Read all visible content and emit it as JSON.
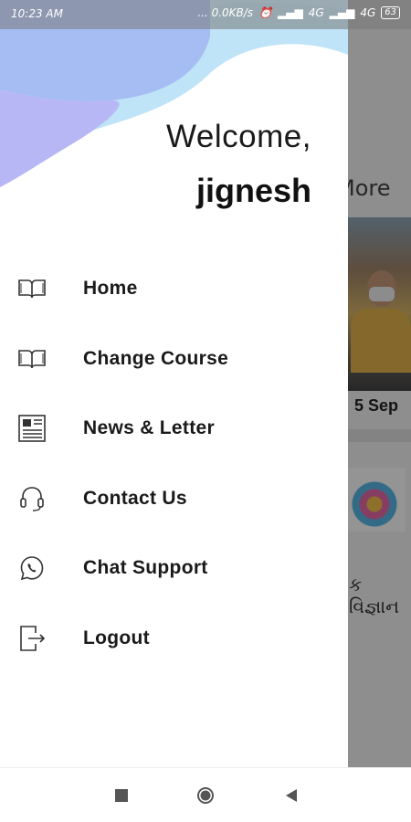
{
  "status_bar": {
    "time": "10:23 AM",
    "speed": "... 0.0KB/s",
    "network1": "4G",
    "network2": "4G",
    "battery": "63"
  },
  "background": {
    "more_text": "More",
    "date_text": "5 Sep",
    "gujarati_text": "ક વિજ્ઞાન"
  },
  "drawer": {
    "welcome": "Welcome,",
    "username": "jignesh",
    "colors": {
      "blob_light": "#bde0f6",
      "blob_blue": "#a8b8f2",
      "blob_lavender": "#b9b6f4"
    },
    "menu": [
      {
        "label": "Home",
        "icon": "book-icon"
      },
      {
        "label": "Change Course",
        "icon": "book-icon"
      },
      {
        "label": "News & Letter",
        "icon": "newspaper-icon"
      },
      {
        "label": "Contact Us",
        "icon": "headset-icon"
      },
      {
        "label": "Chat Support",
        "icon": "whatsapp-icon"
      },
      {
        "label": "Logout",
        "icon": "logout-icon"
      }
    ]
  },
  "nav_bar": {
    "recent": "square-icon",
    "home": "circle-icon",
    "back": "triangle-icon"
  }
}
